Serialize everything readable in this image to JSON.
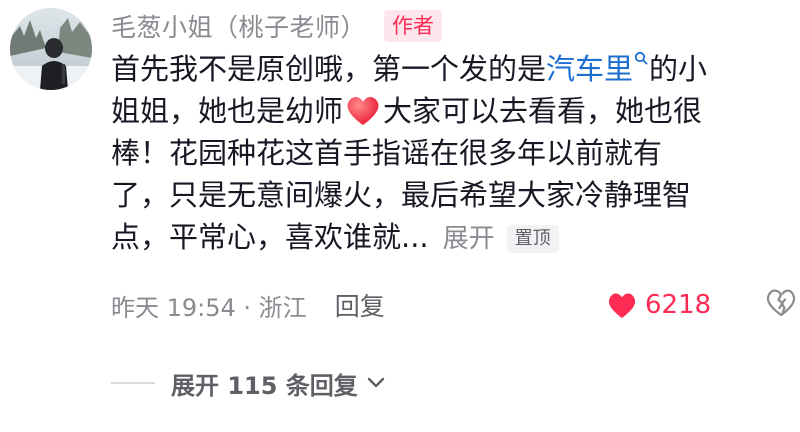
{
  "comment": {
    "username": "毛葱小姐（桃子老师）",
    "author_badge": "作者",
    "text_line1_a": "首先我不是原创哦，第一个发的是",
    "text_line1_link": "汽车里",
    "text_line1_b": "的小",
    "text_line2_a": "姐姐，她也是幼师",
    "text_line2_b": "大家可以去看看，她也很",
    "text_line3": "棒！花园种花这首手指谣在很多年以前就有",
    "text_line4": "了，只是无意间爆火，最后希望大家冷静理智",
    "text_line5": "点，平常心，喜欢谁就...",
    "expand_label": "展开",
    "pin_label": "置顶"
  },
  "meta": {
    "time_location": "昨天 19:54 · 浙江",
    "reply_label": "回复",
    "like_count": "6218"
  },
  "replies": {
    "expand_label": "展开 115 条回复"
  },
  "icons": {
    "search": "search-icon",
    "heart_emoji": "heart-emoji-icon",
    "like": "heart-filled-icon",
    "dislike": "broken-heart-icon",
    "chevron": "chevron-down-icon"
  },
  "colors": {
    "brand_red": "#fe2c55",
    "link_blue": "#1c6fd1",
    "muted_gray": "#8a8b91"
  }
}
